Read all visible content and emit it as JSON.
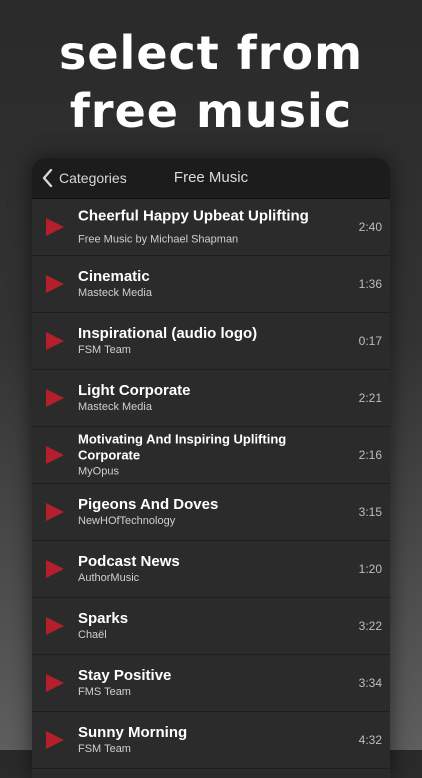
{
  "headline": {
    "line1": "select from",
    "line2": "free music"
  },
  "nav": {
    "back_label": "Categories",
    "title": "Free Music"
  },
  "colors": {
    "play": "#b3202c",
    "background": "#2b2b2b"
  },
  "tracks": [
    {
      "title": "Cheerful Happy Upbeat Uplifting",
      "artist": "Free Music by Michael Shapman",
      "duration": "2:40"
    },
    {
      "title": "Cinematic",
      "artist": "Masteck Media",
      "duration": "1:36"
    },
    {
      "title": "Inspirational (audio logo)",
      "artist": "FSM Team",
      "duration": "0:17"
    },
    {
      "title": "Light Corporate",
      "artist": "Masteck Media",
      "duration": "2:21"
    },
    {
      "title": "Motivating And Inspiring Uplifting Corporate",
      "artist": "MyOpus",
      "duration": "2:16"
    },
    {
      "title": "Pigeons And Doves",
      "artist": "NewHOfTechnology",
      "duration": "3:15"
    },
    {
      "title": "Podcast News",
      "artist": "AuthorMusic",
      "duration": "1:20"
    },
    {
      "title": "Sparks",
      "artist": "Chaël",
      "duration": "3:22"
    },
    {
      "title": "Stay Positive",
      "artist": "FMS Team",
      "duration": "3:34"
    },
    {
      "title": "Sunny Morning",
      "artist": "FSM Team",
      "duration": "4:32"
    }
  ]
}
